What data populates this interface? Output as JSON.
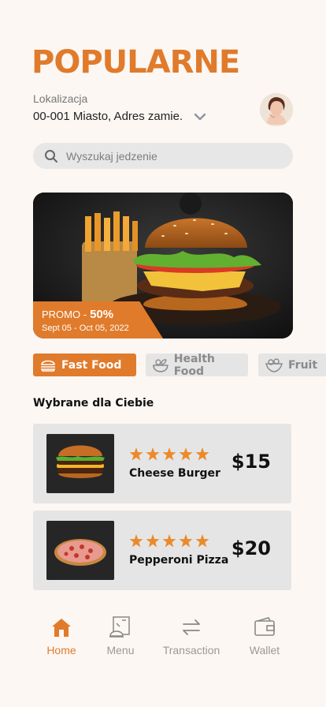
{
  "header": {
    "title": "POPULARNE"
  },
  "location": {
    "label": "Lokalizacja",
    "value": "00-001 Miasto, Adres zamie."
  },
  "search": {
    "placeholder": "Wyszukaj jedzenie"
  },
  "promo": {
    "label": "PROMO -",
    "discount": "50%",
    "dates": "Sept 05 - Oct 05, 2022"
  },
  "categories": [
    {
      "label": "Fast Food",
      "icon": "burger-icon",
      "active": true
    },
    {
      "label": "Health Food",
      "icon": "salad-bowl-icon",
      "active": false
    },
    {
      "label": "Fruit",
      "icon": "fruit-icon",
      "active": false
    }
  ],
  "section": {
    "title": "Wybrane dla Ciebie"
  },
  "items": [
    {
      "name": "Cheese Burger",
      "price": "$15",
      "rating": 5
    },
    {
      "name": "Pepperoni Pizza",
      "price": "$20",
      "rating": 5
    }
  ],
  "nav": [
    {
      "label": "Home",
      "icon": "home-icon",
      "active": true
    },
    {
      "label": "Menu",
      "icon": "menu-icon",
      "active": false
    },
    {
      "label": "Transaction",
      "icon": "transaction-icon",
      "active": false
    },
    {
      "label": "Wallet",
      "icon": "wallet-icon",
      "active": false
    }
  ],
  "colors": {
    "accent": "#e07b2c",
    "background": "#fcf7f3",
    "card": "#e5e5e5",
    "star": "#ec8a2a"
  }
}
